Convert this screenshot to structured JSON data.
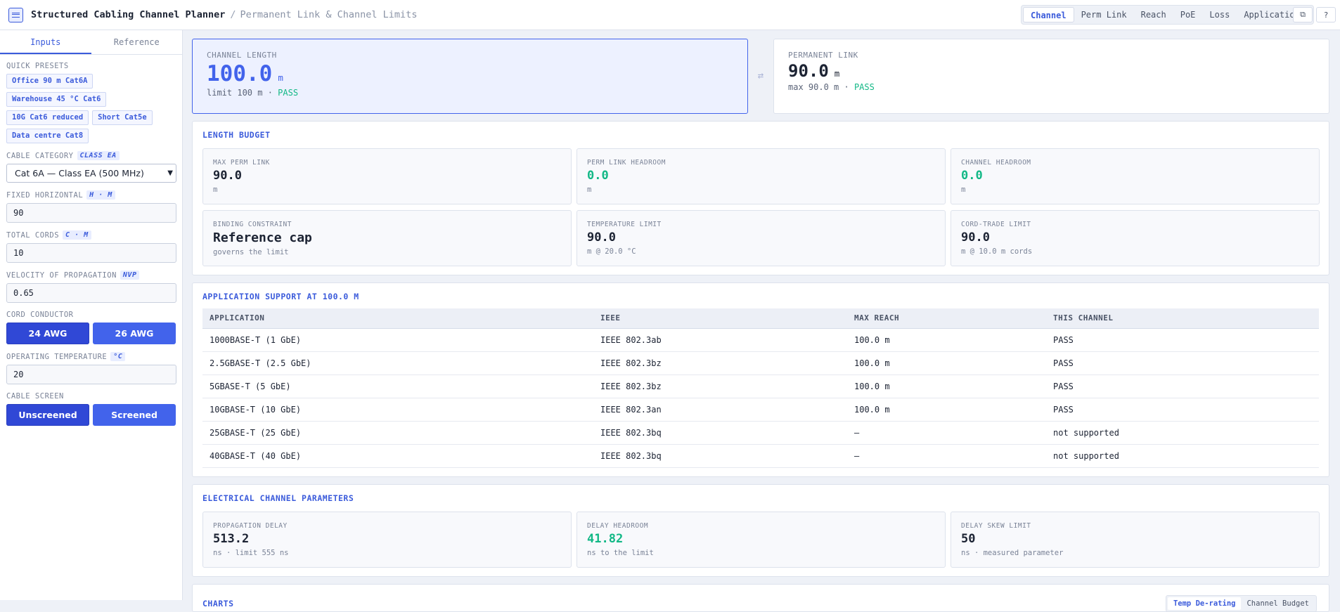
{
  "header": {
    "title": "Structured Cabling Channel Planner",
    "separator": "/",
    "subtitle": "Permanent Link & Channel Limits",
    "nav_tabs": [
      "Channel",
      "Perm Link",
      "Reach",
      "PoE",
      "Loss",
      "Applications"
    ],
    "active_tab": "Channel",
    "icons": [
      "menu-icon",
      "copy-icon",
      "help-icon"
    ]
  },
  "sidebar": {
    "tabs": [
      "Inputs",
      "Reference"
    ],
    "active_tab": "Inputs",
    "presets_label": "QUICK PRESETS",
    "presets": [
      "Office 90 m Cat6A",
      "Warehouse 45 °C Cat6",
      "10G Cat6 reduced",
      "Short Cat5e",
      "Data centre Cat8"
    ],
    "cable_category": {
      "label": "CABLE CATEGORY",
      "tag": "CLASS EA",
      "value": "Cat 6A — Class EA (500 MHz)"
    },
    "fixed_horizontal": {
      "label": "FIXED HORIZONTAL",
      "tag": "H · M",
      "value": "90"
    },
    "total_cords": {
      "label": "TOTAL CORDS",
      "tag": "C · M",
      "value": "10"
    },
    "nvp": {
      "label": "VELOCITY OF PROPAGATION",
      "tag": "NVP",
      "value": "0.65"
    },
    "cord_conductor": {
      "label": "CORD CONDUCTOR",
      "options": [
        "24 AWG",
        "26 AWG"
      ],
      "selected": "24 AWG"
    },
    "temperature": {
      "label": "OPERATING TEMPERATURE",
      "tag": "°C",
      "value": "20"
    },
    "cable_screen": {
      "label": "CABLE SCREEN",
      "options": [
        "Unscreened",
        "Screened"
      ],
      "selected": "Unscreened"
    }
  },
  "hero": {
    "channel": {
      "label": "CHANNEL LENGTH",
      "value": "100.0",
      "unit": "m",
      "sub_prefix": "limit 100 m ·",
      "status": "PASS"
    },
    "swap_icon": "⇄",
    "perm_link": {
      "label": "PERMANENT LINK",
      "value": "90.0",
      "unit": "m",
      "sub_prefix": "max 90.0 m ·",
      "status": "PASS"
    }
  },
  "length_budget": {
    "title": "LENGTH BUDGET",
    "cards": [
      {
        "label": "MAX PERM LINK",
        "value": "90.0",
        "sub": "m",
        "color": "#1c2333"
      },
      {
        "label": "PERM LINK HEADROOM",
        "value": "0.0",
        "sub": "m",
        "color": "#12b886"
      },
      {
        "label": "CHANNEL HEADROOM",
        "value": "0.0",
        "sub": "m",
        "color": "#12b886"
      },
      {
        "label": "BINDING CONSTRAINT",
        "value": "Reference cap",
        "sub": "governs the limit",
        "color": "#1c2333"
      },
      {
        "label": "TEMPERATURE LIMIT",
        "value": "90.0",
        "sub": "m @ 20.0 °C",
        "color": "#1c2333"
      },
      {
        "label": "CORD-TRADE LIMIT",
        "value": "90.0",
        "sub": "m @ 10.0 m cords",
        "color": "#1c2333"
      }
    ]
  },
  "applications": {
    "title": "APPLICATION SUPPORT AT 100.0 M",
    "columns": [
      "APPLICATION",
      "IEEE",
      "MAX REACH",
      "THIS CHANNEL"
    ],
    "rows": [
      [
        "1000BASE-T (1 GbE)",
        "IEEE 802.3ab",
        "100.0 m",
        "PASS"
      ],
      [
        "2.5GBASE-T (2.5 GbE)",
        "IEEE 802.3bz",
        "100.0 m",
        "PASS"
      ],
      [
        "5GBASE-T (5 GbE)",
        "IEEE 802.3bz",
        "100.0 m",
        "PASS"
      ],
      [
        "10GBASE-T (10 GbE)",
        "IEEE 802.3an",
        "100.0 m",
        "PASS"
      ],
      [
        "25GBASE-T (25 GbE)",
        "IEEE 802.3bq",
        "—",
        "not supported"
      ],
      [
        "40GBASE-T (40 GbE)",
        "IEEE 802.3bq",
        "—",
        "not supported"
      ]
    ]
  },
  "electrical": {
    "title": "ELECTRICAL CHANNEL PARAMETERS",
    "cards": [
      {
        "label": "PROPAGATION DELAY",
        "value": "513.2",
        "sub": "ns · limit 555 ns",
        "color": "#1c2333"
      },
      {
        "label": "DELAY HEADROOM",
        "value": "41.82",
        "sub": "ns to the limit",
        "color": "#12b886"
      },
      {
        "label": "DELAY SKEW LIMIT",
        "value": "50",
        "sub": "ns · measured parameter",
        "color": "#1c2333"
      }
    ]
  },
  "charts": {
    "title": "CHARTS",
    "tabs": [
      "Temp De-rating",
      "Channel Budget"
    ],
    "active_tab": "Temp De-rating"
  }
}
